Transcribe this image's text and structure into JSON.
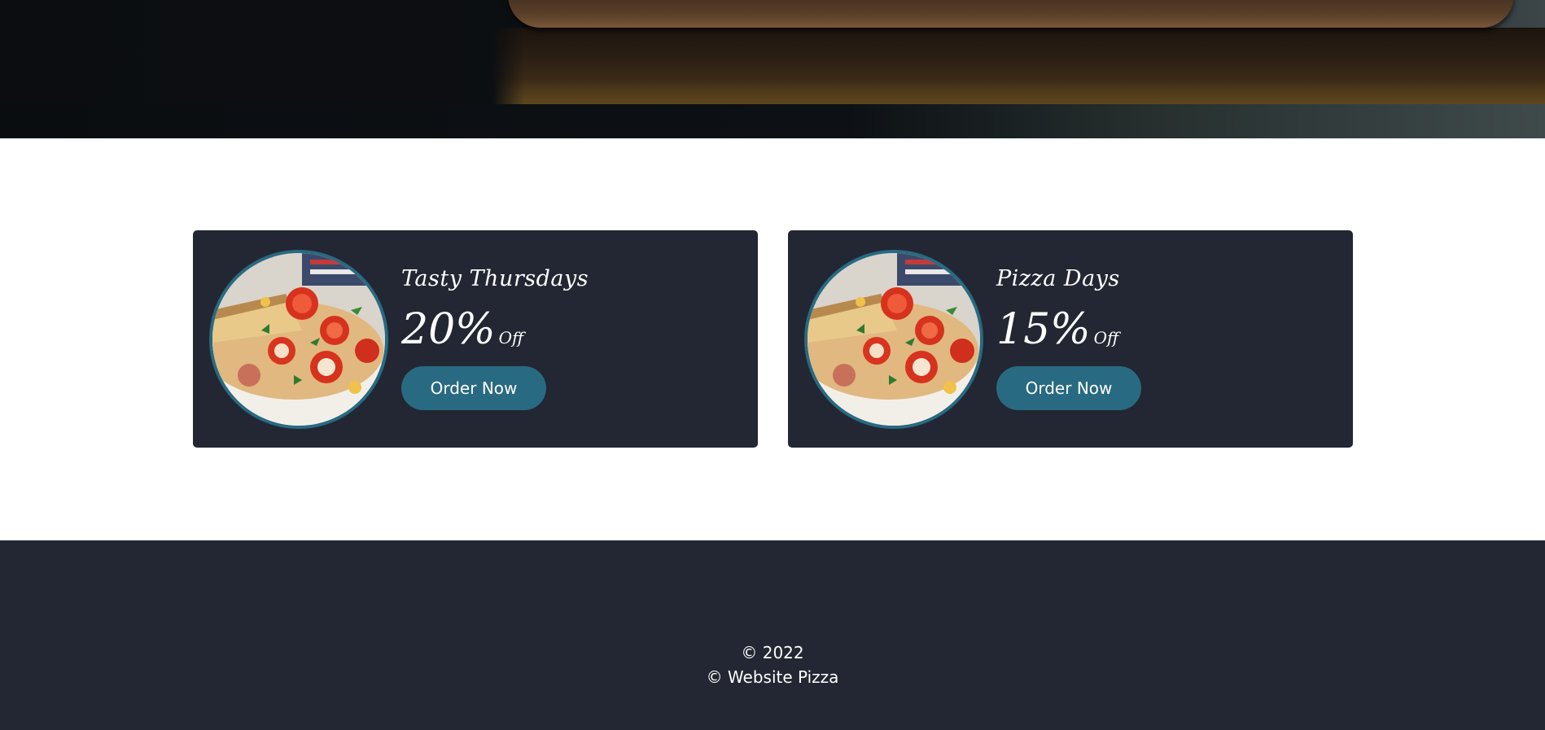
{
  "offers": [
    {
      "title": "Tasty Thursdays",
      "percent": "20%",
      "off_label": "Off",
      "button_label": "Order Now",
      "image": "pizza-photo"
    },
    {
      "title": "Pizza Days",
      "percent": "15%",
      "off_label": "Off",
      "button_label": "Order Now",
      "image": "pizza-photo"
    }
  ],
  "footer": {
    "year_line": "© 2022",
    "site_line": "© Website Pizza"
  },
  "colors": {
    "card_bg": "#222733",
    "accent": "#286a82",
    "footer_bg": "#222733"
  }
}
